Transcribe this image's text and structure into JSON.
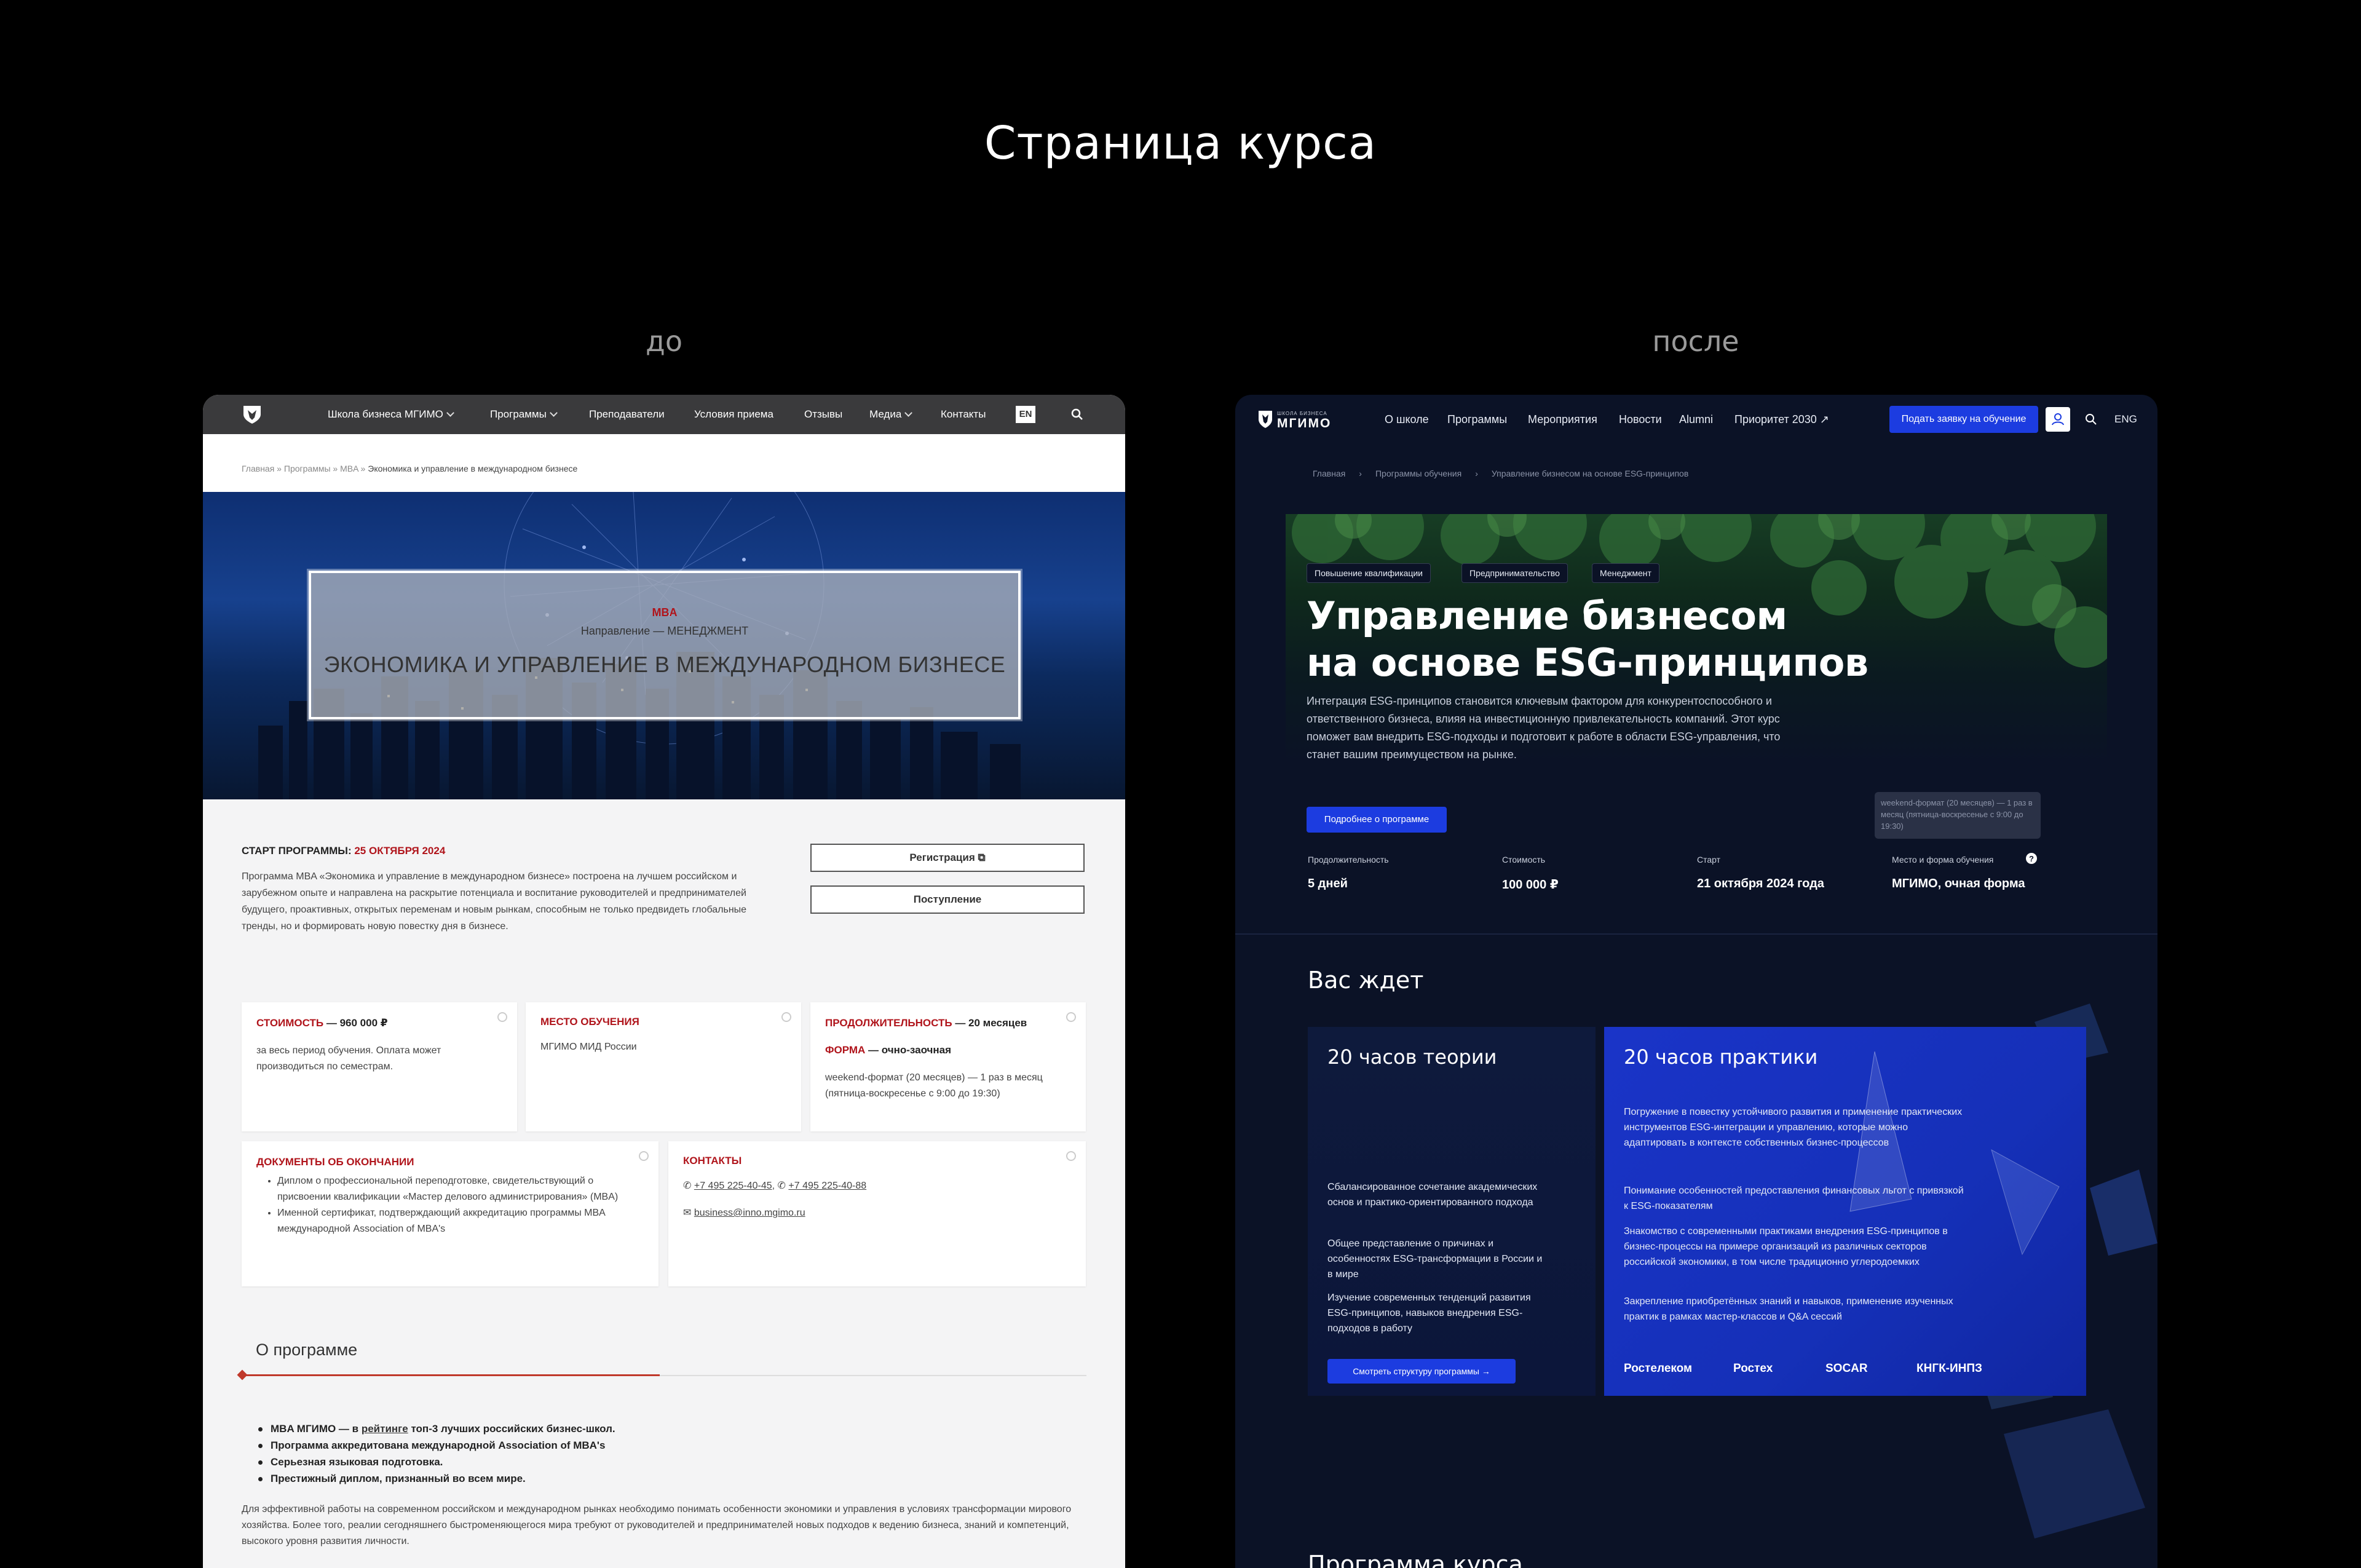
{
  "page_title": "Страница курса",
  "captions": {
    "before": "до",
    "after": "после"
  },
  "before": {
    "nav": {
      "items": [
        "Школа бизнеса МГИМО",
        "Программы",
        "Преподаватели",
        "Условия приема",
        "Отзывы",
        "Медиа",
        "Контакты"
      ],
      "lang": "EN"
    },
    "breadcrumb": {
      "home": "Главная",
      "programs": "Программы",
      "mba": "MBA",
      "current": "Экономика и управление в международном бизнесе",
      "sep": " » "
    },
    "hero": {
      "label": "MBA",
      "direction": "Направление — МЕНЕДЖМЕНТ",
      "title": "ЭКОНОМИКА И УПРАВЛЕНИЕ В МЕЖДУНАРОДНОМ БИЗНЕСЕ"
    },
    "start": {
      "label": "СТАРТ ПРОГРАММЫ:",
      "date": "25 ОКТЯБРЯ 2024"
    },
    "description": "Программа MBA «Экономика и управление в международном бизнесе» построена на лучшем российском и зарубежном опыте и направлена на раскрытие потенциала и воспитание руководителей и предпринимателей будущего, проактивных, открытых переменам и новым рынкам, способным не только предвидеть глобальные тренды, но и формировать новую повестку дня в бизнесе.",
    "buttons": {
      "registration": "Регистрация",
      "admission": "Поступление"
    },
    "cards": {
      "cost": {
        "label": "СТОИМОСТЬ",
        "value": "— 960 000 ₽",
        "text": "за весь период обучения. Оплата может производиться по семестрам."
      },
      "place": {
        "label": "МЕСТО ОБУЧЕНИЯ",
        "text": "МГИМО МИД России"
      },
      "duration": {
        "label": "ПРОДОЛЖИТЕЛЬНОСТЬ",
        "value": "— 20 месяцев",
        "form_label": "ФОРМА",
        "form_value": "— очно-заочная",
        "text": "weekend-формат (20 месяцев) — 1 раз в месяц (пятница-воскресенье с 9:00 до 19:30)"
      },
      "docs": {
        "label": "ДОКУМЕНТЫ ОБ ОКОНЧАНИИ",
        "items": [
          "Диплом о профессиональной переподготовке, свидетельствующий о присвоении квалификации «Мастер делового администрирования» (MBA)",
          "Именной сертификат, подтверждающий аккредитацию программы MBA международной Association of MBA's"
        ]
      },
      "contacts": {
        "label": "КОНТАКТЫ",
        "phone1": "+7 495 225-40-45",
        "phone2": "+7 495 225-40-88",
        "email": "business@inno.mgimo.ru"
      }
    },
    "about": {
      "title": "О программе",
      "bullet1_pre": "MBA МГИМО — в ",
      "bullet1_link": "рейтинге",
      "bullet1_post": " топ-3 лучших российских бизнес-школ.",
      "bullets": [
        "Программа аккредитована международной Association of MBA's",
        "Серьезная языковая подготовка.",
        "Престижный диплом, признанный во всем мире."
      ],
      "paragraph": "Для эффективной работы на современном российском и международном рынках необходимо понимать особенности экономики и управления в условиях трансформации мирового хозяйства. Более того, реалии сегодняшнего быстроменяющегося мира требуют от руководителей и предпринимателей новых подходов к ведению бизнеса, знаний и компетенций, высокого уровня развития личности."
    }
  },
  "after": {
    "logo": {
      "top": "ШКОЛА БИЗНЕСА",
      "main": "МГИМО"
    },
    "nav": {
      "items": [
        "О школе",
        "Программы",
        "Мероприятия",
        "Новости",
        "Alumni",
        "Приоритет 2030"
      ],
      "cta": "Подать заявку на обучение",
      "lang": "ENG"
    },
    "breadcrumb": [
      "Главная",
      "Программы обучения",
      "Управление бизнесом на основе ESG-принципов"
    ],
    "tags": [
      "Повышение квалификации",
      "Предпринимательство",
      "Менеджмент"
    ],
    "hero": {
      "title_line1": "Управление бизнесом",
      "title_line2": "на основе ESG-принципов",
      "description": "Интеграция ESG-принципов становится ключевым фактором для конкурентоспособного и ответственного бизнеса, влияя на инвестиционную привлекательность компаний. Этот курс поможет вам внедрить ESG-подходы и подготовит к работе в области ESG-управления, что станет вашим преимуществом на рынке.",
      "more_button": "Подробнее о программе",
      "tooltip": "weekend-формат (20 месяцев) — 1 раз в месяц (пятница-воскресенье с 9:00 до 19:30)"
    },
    "stats": [
      {
        "label": "Продолжительность",
        "value": "5 дней"
      },
      {
        "label": "Стоимость",
        "value": "100 000 ₽"
      },
      {
        "label": "Старт",
        "value": "21 октября 2024 года"
      },
      {
        "label": "Место и форма обучения",
        "value": "МГИМО, очная форма"
      }
    ],
    "awaits": {
      "title": "Вас ждет",
      "theory": {
        "title": "20 часов теории",
        "items": [
          "Сбалансированное сочетание академических основ и практико-ориентированного подхода",
          "Общее представление о причинах и особенностях ESG-трансформации в России и в мире",
          "Изучение современных тенденций развития ESG-принципов, навыков внедрения ESG-подходов в работу"
        ],
        "button": "Смотреть структуру программы"
      },
      "practice": {
        "title": "20 часов практики",
        "items": [
          "Погружение в повестку устойчивого развития и применение практических инструментов ESG-интеграции и управлению, которые можно адаптировать в контексте собственных бизнес-процессов",
          "Понимание особенностей предоставления финансовых льгот с привязкой к ESG-показателям",
          "Знакомство с современными практиками внедрения ESG-принципов в бизнес-процессы на примере организаций из различных секторов российской экономики, в том числе традиционно углеродоемких",
          "Закрепление приобретённых знаний и навыков, применение изученных практик в рамках мастер-классов и Q&A сессий"
        ],
        "partners": [
          "Ростелеком",
          "Ростех",
          "SOCAR",
          "КНГК-ИНПЗ"
        ]
      }
    },
    "program_heading": "Программа курса",
    "colors": {
      "accent": "#1c3ce0",
      "bg": "#0b1226",
      "old_red": "#b0141b"
    }
  }
}
